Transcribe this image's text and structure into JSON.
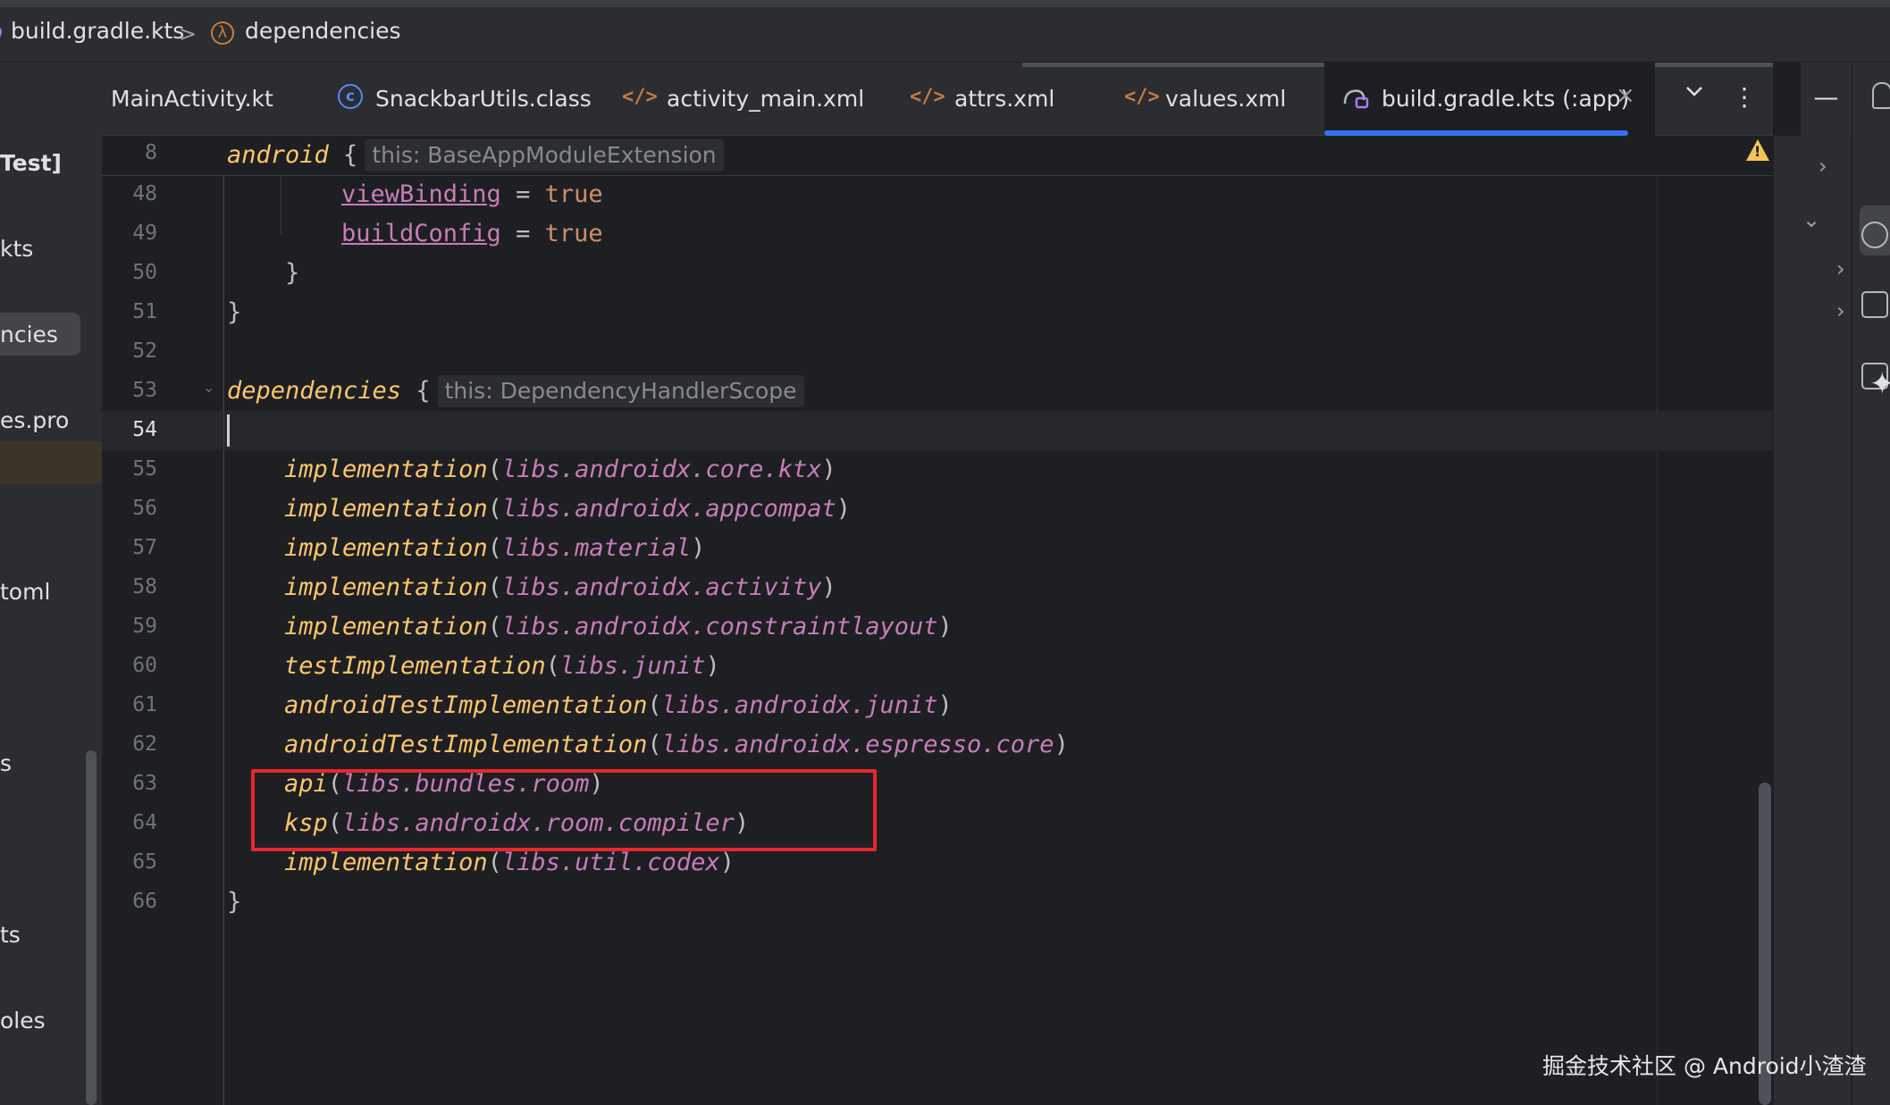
{
  "breadcrumb": {
    "file": "build.gradle.kts",
    "separator": ">",
    "symbol": "dependencies"
  },
  "project_pane": {
    "items": [
      "Test]",
      "kts",
      "ncies",
      "es.pro",
      "toml",
      "s",
      "ts",
      "oles"
    ]
  },
  "tabs": [
    {
      "label": "MainActivity.kt",
      "icon": "kotlin-file-icon"
    },
    {
      "label": "SnackbarUtils.class",
      "icon": "class-file-icon"
    },
    {
      "label": "activity_main.xml",
      "icon": "xml-file-icon"
    },
    {
      "label": "attrs.xml",
      "icon": "xml-file-icon"
    },
    {
      "label": "values.xml",
      "icon": "xml-file-icon"
    },
    {
      "label": "build.gradle.kts (:app)",
      "icon": "gradle-file-icon",
      "active": true,
      "close": "×"
    }
  ],
  "tab_controls": {
    "more_tabs": "⌄",
    "menu": "⋮",
    "minimize": "—"
  },
  "editor": {
    "sticky": {
      "line": "8",
      "keyword": "android",
      "brace": " {",
      "hint": "this: BaseAppModuleExtension"
    },
    "lines": [
      {
        "n": "48",
        "prop": "viewBinding",
        "eq": " = ",
        "val": "true"
      },
      {
        "n": "49",
        "prop": "buildConfig",
        "eq": " = ",
        "val": "true"
      },
      {
        "n": "50",
        "text": "    }"
      },
      {
        "n": "51",
        "text": "}"
      },
      {
        "n": "52",
        "text": ""
      },
      {
        "n": "53",
        "keyword": "dependencies",
        "brace": " {",
        "hint": "this: DependencyHandlerScope"
      },
      {
        "n": "54",
        "text": ""
      },
      {
        "n": "55",
        "fn": "implementation",
        "arg": "libs.androidx.core.ktx"
      },
      {
        "n": "56",
        "fn": "implementation",
        "arg": "libs.androidx.appcompat"
      },
      {
        "n": "57",
        "fn": "implementation",
        "arg": "libs.material"
      },
      {
        "n": "58",
        "fn": "implementation",
        "arg": "libs.androidx.activity"
      },
      {
        "n": "59",
        "fn": "implementation",
        "arg": "libs.androidx.constraintlayout"
      },
      {
        "n": "60",
        "fn": "testImplementation",
        "arg": "libs.junit"
      },
      {
        "n": "61",
        "fn": "androidTestImplementation",
        "arg": "libs.androidx.junit"
      },
      {
        "n": "62",
        "fn": "androidTestImplementation",
        "arg": "libs.androidx.espresso.core"
      },
      {
        "n": "63",
        "fn": "api",
        "arg": "libs.bundles.room"
      },
      {
        "n": "64",
        "fn": "ksp",
        "arg": "libs.androidx.room.compiler"
      },
      {
        "n": "65",
        "fn": "implementation",
        "arg": "libs.util.codex"
      },
      {
        "n": "66",
        "text": "}"
      }
    ],
    "paren_open": "(",
    "paren_close": ")",
    "warning_icon": "warning-icon"
  },
  "watermark": "掘金技术社区 @ Android小渣渣",
  "colors": {
    "accent": "#3574f0",
    "highlight_box": "#e8272a",
    "function": "#ffc66d",
    "library": "#c77dbb",
    "boolean": "#cf8e6d"
  }
}
